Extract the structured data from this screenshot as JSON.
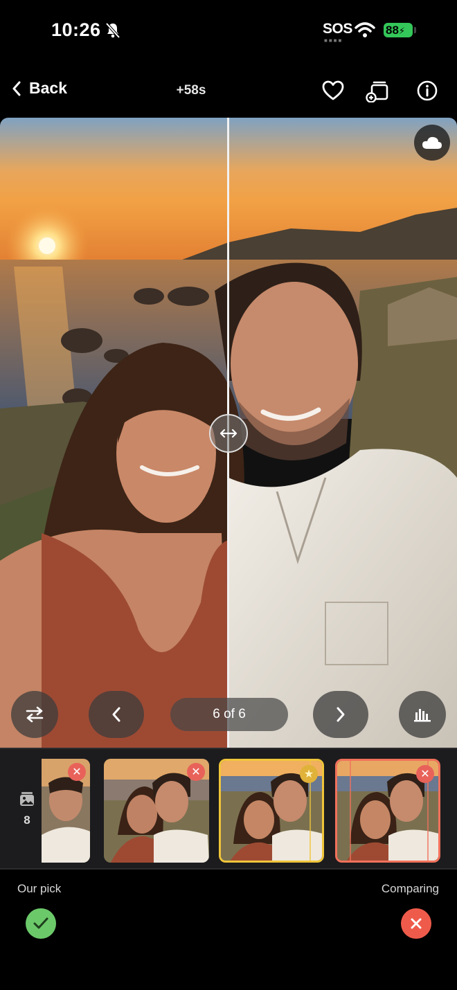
{
  "status_bar": {
    "time": "10:26",
    "sos": "SOS",
    "battery": "88"
  },
  "nav": {
    "back_label": "Back",
    "title": "+58s"
  },
  "viewer": {
    "counter": "6 of 6"
  },
  "strip": {
    "stack_count": "8",
    "thumbnails": [
      {
        "state": "rejected"
      },
      {
        "state": "rejected"
      },
      {
        "state": "our-pick"
      },
      {
        "state": "comparing"
      }
    ]
  },
  "footer": {
    "left_label": "Our pick",
    "right_label": "Comparing"
  },
  "colors": {
    "pick_accent": "#f0c53a",
    "compare_accent": "#f2715b",
    "battery_green": "#34c759",
    "check_green": "#6cc96a",
    "reject_red": "#ef5b4b"
  }
}
